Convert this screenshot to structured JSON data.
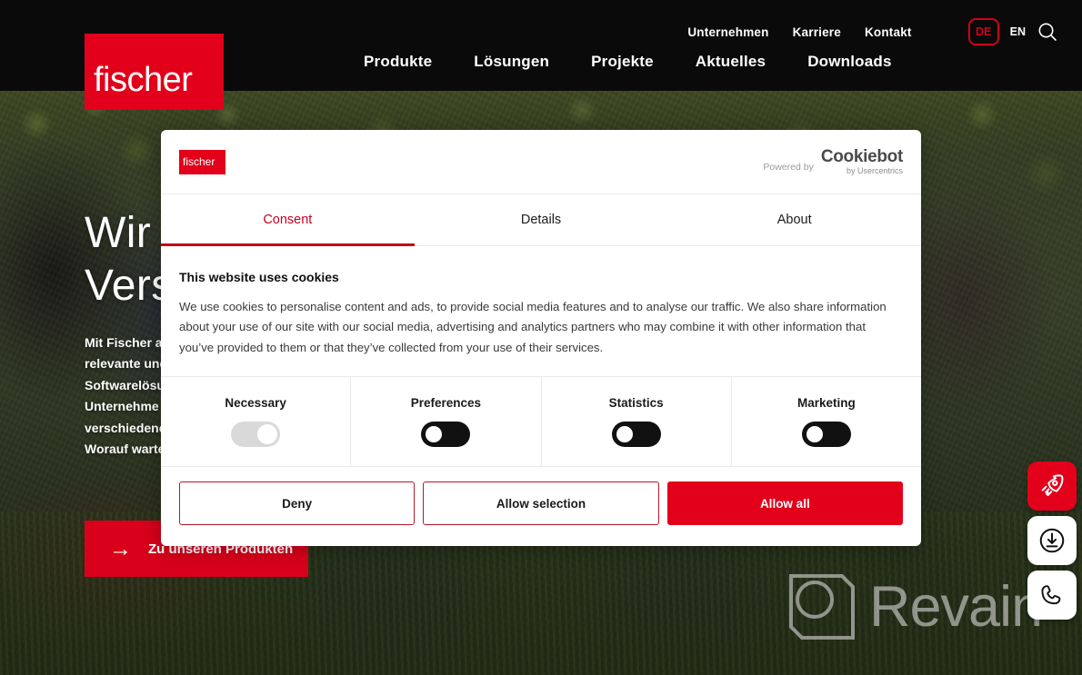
{
  "site": {
    "logo_text": "fischer",
    "meta_nav": [
      {
        "label": "Unternehmen"
      },
      {
        "label": "Karriere"
      },
      {
        "label": "Kontakt"
      }
    ],
    "language": {
      "active": "DE",
      "alternate": "EN"
    },
    "search_icon": "search-icon",
    "main_nav": [
      {
        "label": "Produkte"
      },
      {
        "label": "Lösungen"
      },
      {
        "label": "Projekte"
      },
      {
        "label": "Aktuelles"
      },
      {
        "label": "Downloads"
      }
    ]
  },
  "hero": {
    "title": "Wir e\nVerst",
    "body": "Mit Fischer a\nrelevante und\nSoftwarelösu\nUnternehme\nverschiedene\nWorauf warte",
    "cta": {
      "arrow": "→",
      "label": "Zu unseren Produkten"
    }
  },
  "widgets": [
    {
      "name": "rocket-widget",
      "icon": "rocket-icon",
      "color": "#e2001a"
    },
    {
      "name": "download-widget",
      "icon": "download-icon",
      "color": "#ffffff"
    },
    {
      "name": "phone-widget",
      "icon": "phone-icon",
      "color": "#ffffff"
    }
  ],
  "watermark": {
    "text": "Revain",
    "logo": "revain-logo-icon"
  },
  "cookie_dialog": {
    "logo_text": "fischer",
    "powered_by_label": "Powered by",
    "brand": "Cookiebot",
    "brand_sub": "by Usercentrics",
    "tabs": [
      {
        "label": "Consent",
        "active": true
      },
      {
        "label": "Details",
        "active": false
      },
      {
        "label": "About",
        "active": false
      }
    ],
    "body_title": "This website uses cookies",
    "body_text": "We use cookies to personalise content and ads, to provide social media features and to analyse our traffic. We also share information about your use of our site with our social media, advertising and analytics partners who may combine it with other information that you’ve provided to them or that they’ve collected from your use of their services.",
    "categories": [
      {
        "label": "Necessary",
        "state": "locked-on"
      },
      {
        "label": "Preferences",
        "state": "off"
      },
      {
        "label": "Statistics",
        "state": "off"
      },
      {
        "label": "Marketing",
        "state": "off"
      }
    ],
    "buttons": {
      "deny": "Deny",
      "allow_selection": "Allow selection",
      "allow_all": "Allow all"
    }
  },
  "colors": {
    "brand_red": "#e2001a",
    "accent_red": "#c2021b",
    "header_black": "#0a0a0a"
  }
}
